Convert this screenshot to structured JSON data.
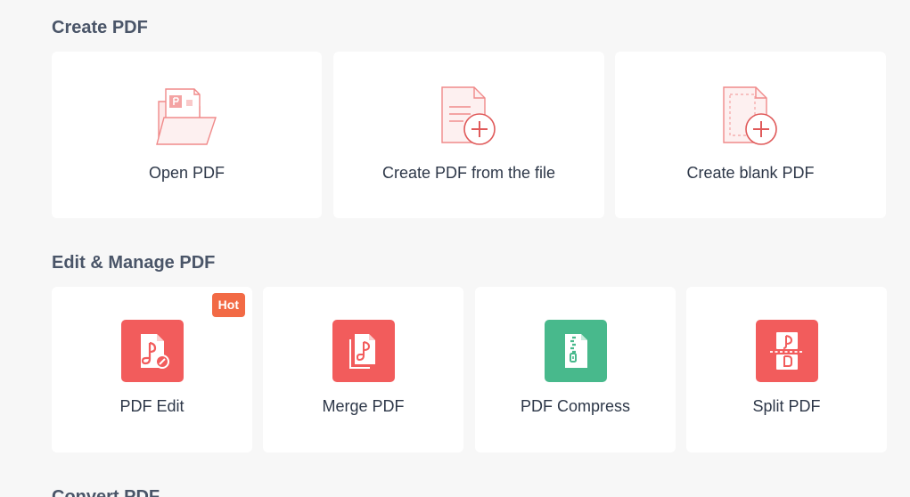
{
  "sections": {
    "create": {
      "title": "Create PDF",
      "cards": [
        {
          "label": "Open PDF",
          "icon": "open-folder-pdf-icon"
        },
        {
          "label": "Create PDF from the file",
          "icon": "file-add-icon"
        },
        {
          "label": "Create blank PDF",
          "icon": "blank-file-add-icon"
        }
      ]
    },
    "edit": {
      "title": "Edit & Manage PDF",
      "hot_badge": "Hot",
      "cards": [
        {
          "label": "PDF Edit",
          "icon": "pdf-edit-icon"
        },
        {
          "label": "Merge PDF",
          "icon": "merge-pdf-icon"
        },
        {
          "label": "PDF Compress",
          "icon": "pdf-compress-icon"
        },
        {
          "label": "Split PDF",
          "icon": "split-pdf-icon"
        }
      ]
    },
    "convert": {
      "title": "Convert PDF"
    }
  },
  "colors": {
    "accent_red": "#f25c5c",
    "accent_green": "#48b98c",
    "hot_badge": "#f26a45",
    "section_title": "#4a5568",
    "card_background": "#ffffff",
    "page_background": "#f7f7f7"
  }
}
